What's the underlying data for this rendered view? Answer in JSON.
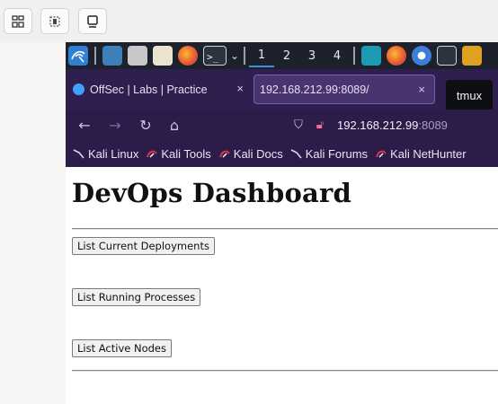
{
  "browser": {
    "tabs": [
      {
        "title": "OffSec | Labs | Practice",
        "close_label": "×"
      },
      {
        "title": "192.168.212.99:8089/",
        "close_label": "×"
      }
    ],
    "tooltip": "tmux",
    "url": {
      "host": "192.168.212.99",
      "port": ":8089"
    },
    "bookmarks": [
      "Kali Linux",
      "Kali Tools",
      "Kali Docs",
      "Kali Forums",
      "Kali NetHunter"
    ]
  },
  "panel": {
    "workspaces": [
      "1",
      "2",
      "3",
      "4"
    ],
    "active_workspace": "1"
  },
  "page": {
    "title": "DevOps Dashboard",
    "buttons": [
      "List Current Deployments",
      "List Running Processes",
      "List Active Nodes"
    ]
  },
  "colors": {
    "kali_panel": "#1d212b",
    "firefox_chrome": "#2e1f4f",
    "accent_blue": "#3d8fdd"
  }
}
